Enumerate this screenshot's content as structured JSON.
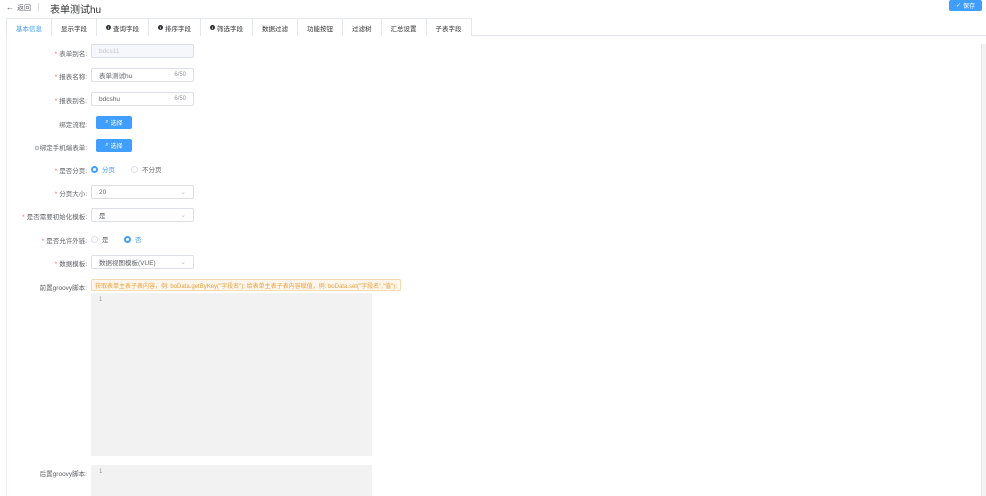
{
  "header": {
    "back_label": "返回",
    "title": "表单测试hu",
    "save_label": "保存"
  },
  "tabs": [
    {
      "label": "基本信息",
      "active": true,
      "info": false
    },
    {
      "label": "显示字段",
      "active": false,
      "info": false
    },
    {
      "label": "查询字段",
      "active": false,
      "info": true
    },
    {
      "label": "排序字段",
      "active": false,
      "info": true
    },
    {
      "label": "筛选字段",
      "active": false,
      "info": true
    },
    {
      "label": "数据过滤",
      "active": false,
      "info": false
    },
    {
      "label": "功能按钮",
      "active": false,
      "info": false
    },
    {
      "label": "过滤树",
      "active": false,
      "info": false
    },
    {
      "label": "汇总设置",
      "active": false,
      "info": false
    },
    {
      "label": "子表字段",
      "active": false,
      "info": false
    }
  ],
  "form": {
    "alias_label": "表单别名:",
    "alias_value": "bdcs11",
    "report_name_label": "报表名称:",
    "report_name_value": "表单测试hu",
    "report_name_count": "6/50",
    "report_alias_label": "报表别名:",
    "report_alias_value": "bdcshu",
    "report_alias_count": "6/50",
    "bind_flow_label": "绑定流程:",
    "select_label": "选择",
    "bind_mobile_label": "绑定手机端表单:",
    "paging_label": "是否分页:",
    "paging_yes": "分页",
    "paging_no": "不分页",
    "page_size_label": "分页大小:",
    "page_size_value": "20",
    "init_query_label": "是否需要初始化模板:",
    "init_query_value": "是",
    "allow_export_label": "是否允许外链:",
    "export_yes": "是",
    "export_no": "否",
    "data_template_label": "数据模板:",
    "data_template_value": "数据视图模板(VUE)",
    "pre_script_label": "前置groovy脚本:",
    "pre_script_hint": "获取表单主表子表内容，例: boData.getByKey(\"字段名\"); 给表单主表子表内容赋值，例: boData.set(\"字段名\",\"值\");",
    "pre_script_line": "1",
    "post_script_label": "后置groovy脚本:",
    "post_script_line": "1"
  },
  "colors": {
    "primary": "#409eff",
    "required": "#f56c6c",
    "warning": "#e6a23c"
  }
}
